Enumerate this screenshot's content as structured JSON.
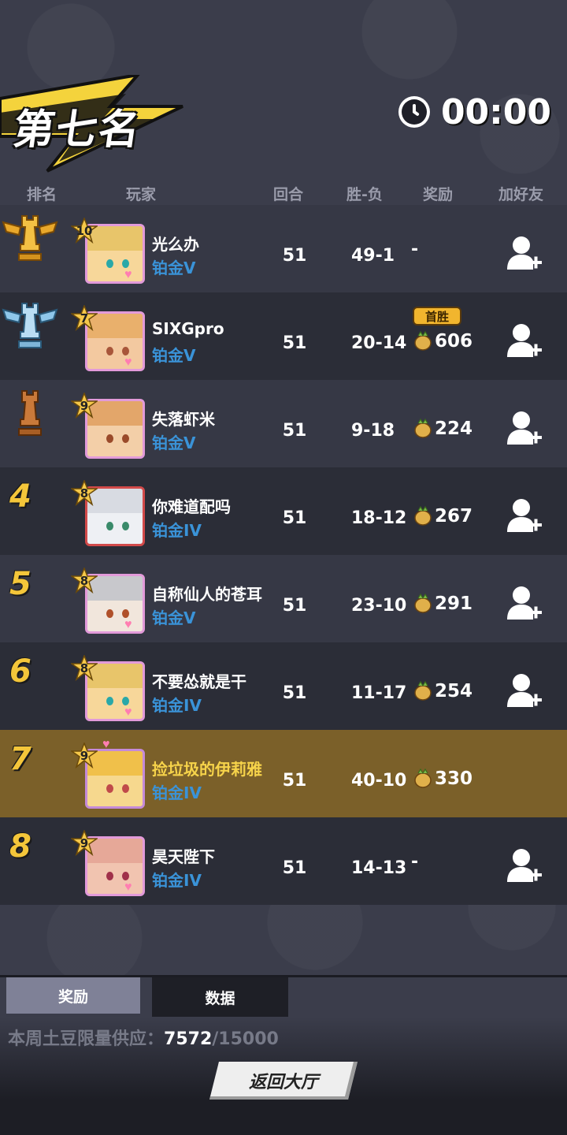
{
  "header": {
    "placement_title": "第七名",
    "timer": "00:00"
  },
  "columns": {
    "rank": "排名",
    "player": "玩家",
    "rounds": "回合",
    "win_loss": "胜-负",
    "reward": "奖励",
    "add_friend": "加好友"
  },
  "rows": [
    {
      "rank": "1",
      "level": "10",
      "name": "光么办",
      "tier": "铂金V",
      "rounds": "51",
      "wl": "49-1",
      "reward": "-",
      "first_win": "",
      "add_friend": true
    },
    {
      "rank": "2",
      "level": "7",
      "name": "SIXGpro",
      "tier": "铂金V",
      "rounds": "51",
      "wl": "20-14",
      "reward": "606",
      "first_win": "首胜",
      "add_friend": true
    },
    {
      "rank": "3",
      "level": "9",
      "name": "失落虾米",
      "tier": "铂金V",
      "rounds": "51",
      "wl": "9-18",
      "reward": "224",
      "first_win": "",
      "add_friend": true
    },
    {
      "rank": "4",
      "level": "8",
      "name": "你难道配吗",
      "tier": "铂金IV",
      "rounds": "51",
      "wl": "18-12",
      "reward": "267",
      "first_win": "",
      "add_friend": true
    },
    {
      "rank": "5",
      "level": "8",
      "name": "自称仙人的苍耳",
      "tier": "铂金V",
      "rounds": "51",
      "wl": "23-10",
      "reward": "291",
      "first_win": "",
      "add_friend": true
    },
    {
      "rank": "6",
      "level": "8",
      "name": "不要怂就是干",
      "tier": "铂金IV",
      "rounds": "51",
      "wl": "11-17",
      "reward": "254",
      "first_win": "",
      "add_friend": true
    },
    {
      "rank": "7",
      "level": "9",
      "name": "捡垃圾的伊莉雅",
      "tier": "铂金IV",
      "rounds": "51",
      "wl": "40-10",
      "reward": "330",
      "first_win": "",
      "add_friend": false
    },
    {
      "rank": "8",
      "level": "9",
      "name": "昊天陛下",
      "tier": "铂金IV",
      "rounds": "51",
      "wl": "14-13",
      "reward": "-",
      "first_win": "",
      "add_friend": true
    }
  ],
  "tabs": {
    "rewards": "奖励",
    "data": "数据"
  },
  "supply": {
    "label": "本周土豆限量供应：",
    "current": "7572",
    "total": "/15000"
  },
  "return_button": "返回大厅",
  "icons": {
    "timer": "clock-icon",
    "reward": "potato-icon",
    "add_friend": "add-friend-icon",
    "top_ranks": [
      "gold-rook-trophy-icon",
      "silver-rook-trophy-icon",
      "bronze-rook-trophy-icon"
    ]
  },
  "colors": {
    "background": "#3b3d4b",
    "highlight_row": "#7b6029",
    "rank_number": "#f4c63a",
    "tier_text": "#3a93d8",
    "banner_yellow": "#f4d33c"
  }
}
